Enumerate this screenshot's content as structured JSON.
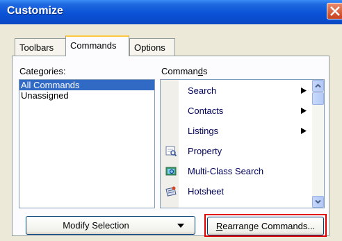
{
  "window": {
    "title": "Customize"
  },
  "tabs": [
    {
      "label": "Toolbars"
    },
    {
      "label": "Commands"
    },
    {
      "label": "Options"
    }
  ],
  "categories": {
    "label_pre": "Cate",
    "label_accel": "g",
    "label_post": "ories:",
    "items": [
      "All Commands",
      "Unassigned"
    ],
    "selected": "All Commands"
  },
  "commands": {
    "label_pre": "Comman",
    "label_accel": "d",
    "label_post": "s",
    "items": [
      {
        "label": "Search",
        "icon": "none",
        "submenu": true
      },
      {
        "label": "Contacts",
        "icon": "none",
        "submenu": true
      },
      {
        "label": "Listings",
        "icon": "none",
        "submenu": true
      },
      {
        "label": "Property",
        "icon": "property-icon",
        "submenu": false
      },
      {
        "label": "Multi-Class Search",
        "icon": "multi-class-search-icon",
        "submenu": false
      },
      {
        "label": "Hotsheet",
        "icon": "hotsheet-icon",
        "submenu": false
      }
    ]
  },
  "buttons": {
    "modify_selection": "Modify Selection",
    "rearrange_accel": "R",
    "rearrange_rest": "earrange Commands..."
  },
  "colors": {
    "titlebar": "#0a52d6",
    "selection": "#316ac5",
    "highlight_box": "#e00000",
    "active_tab_accent": "#ffc83c"
  }
}
